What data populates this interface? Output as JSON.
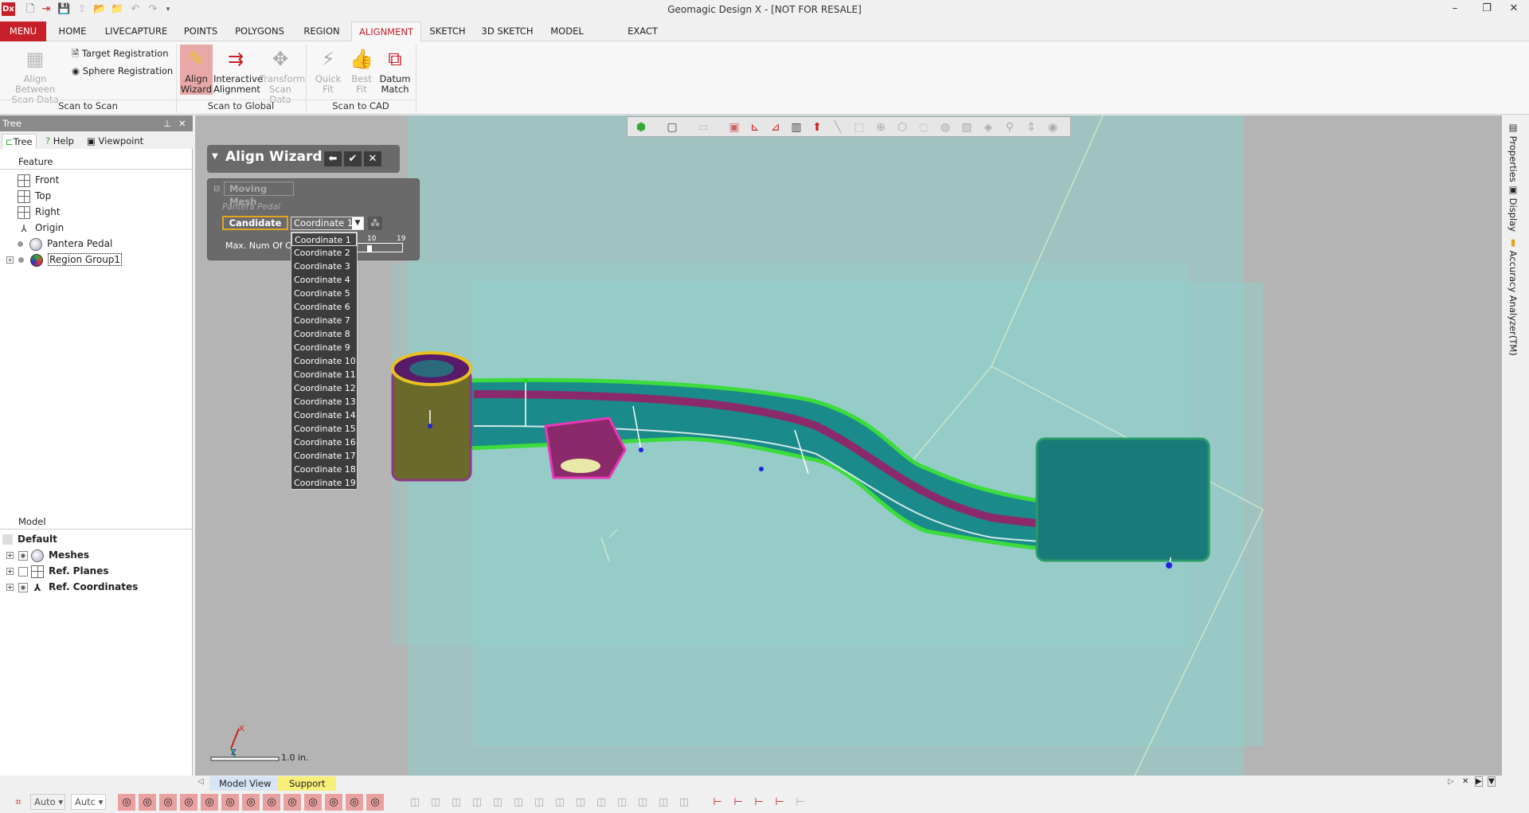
{
  "app": {
    "title": "Geomagic Design X - [NOT FOR RESALE]",
    "logo": "Dx"
  },
  "quick_access": [
    "new-icon",
    "import-icon",
    "save-icon",
    "export-icon",
    "open-icon",
    "open-settings-icon",
    "undo-icon",
    "redo-icon",
    "customize-icon"
  ],
  "window_controls": {
    "minimize": "–",
    "restore": "❐",
    "close": "✕"
  },
  "tabs": [
    {
      "label": "MENU"
    },
    {
      "label": "HOME"
    },
    {
      "label": "LIVECAPTURE"
    },
    {
      "label": "POINTS"
    },
    {
      "label": "POLYGONS"
    },
    {
      "label": "REGION"
    },
    {
      "label": "ALIGNMENT",
      "active": true
    },
    {
      "label": "SKETCH"
    },
    {
      "label": "3D SKETCH"
    },
    {
      "label": "MODEL"
    },
    {
      "label": "EXACT SURFACING"
    }
  ],
  "ribbon": {
    "groups": [
      "Scan to Scan",
      "Scan to Global",
      "Scan to CAD"
    ],
    "align_between": "Align Between Scan Data",
    "target_registration": "Target Registration",
    "sphere_registration": "Sphere Registration",
    "align_wizard": "Align Wizard",
    "interactive_alignment": "Interactive Alignment",
    "transform_scan_data": "Transform Scan Data",
    "quick_fit": "Quick Fit",
    "best_fit": "Best Fit",
    "datum_match": "Datum Match"
  },
  "tree_panel": {
    "title": "Tree",
    "tabs": [
      "Tree",
      "Help",
      "Viewpoint"
    ],
    "feature_header": "Feature",
    "features": [
      "Front",
      "Top",
      "Right",
      "Origin",
      "Pantera Pedal",
      "Region Group1"
    ],
    "model_header": "Model",
    "model_items": [
      "Default",
      "Meshes",
      "Ref. Planes",
      "Ref. Coordinates"
    ]
  },
  "wizard": {
    "title": "Align Wizard",
    "moving_mesh": "Moving Mesh",
    "mesh_name": "Pantera Pedal",
    "candidate": "Candidate",
    "selected": "Coordinate 1",
    "max_label": "Max. Num Of Ca",
    "slider_min_label": "10",
    "slider_max_label": "19",
    "slider_value": 10,
    "options": [
      "Coordinate 1",
      "Coordinate 2",
      "Coordinate 3",
      "Coordinate 4",
      "Coordinate 5",
      "Coordinate 6",
      "Coordinate 7",
      "Coordinate 8",
      "Coordinate 9",
      "Coordinate 10",
      "Coordinate 11",
      "Coordinate 12",
      "Coordinate 13",
      "Coordinate 14",
      "Coordinate 15",
      "Coordinate 16",
      "Coordinate 17",
      "Coordinate 18",
      "Coordinate 19"
    ]
  },
  "viewport": {
    "scale_label": "1.0 in.",
    "plane_color": "#8fd0cc",
    "background": "#b4b4b4"
  },
  "right_panel": [
    "Properties",
    "Display",
    "Accuracy Analyzer(TM)"
  ],
  "bottom_tabs": [
    "Model View",
    "Support"
  ],
  "bottom_toolbar": {
    "select1": "Auto",
    "select2": "Autc"
  },
  "colors": {
    "accent": "#c8202a",
    "support_tab": "#f7ef7a",
    "model_view_tab": "#d6e4f5"
  }
}
